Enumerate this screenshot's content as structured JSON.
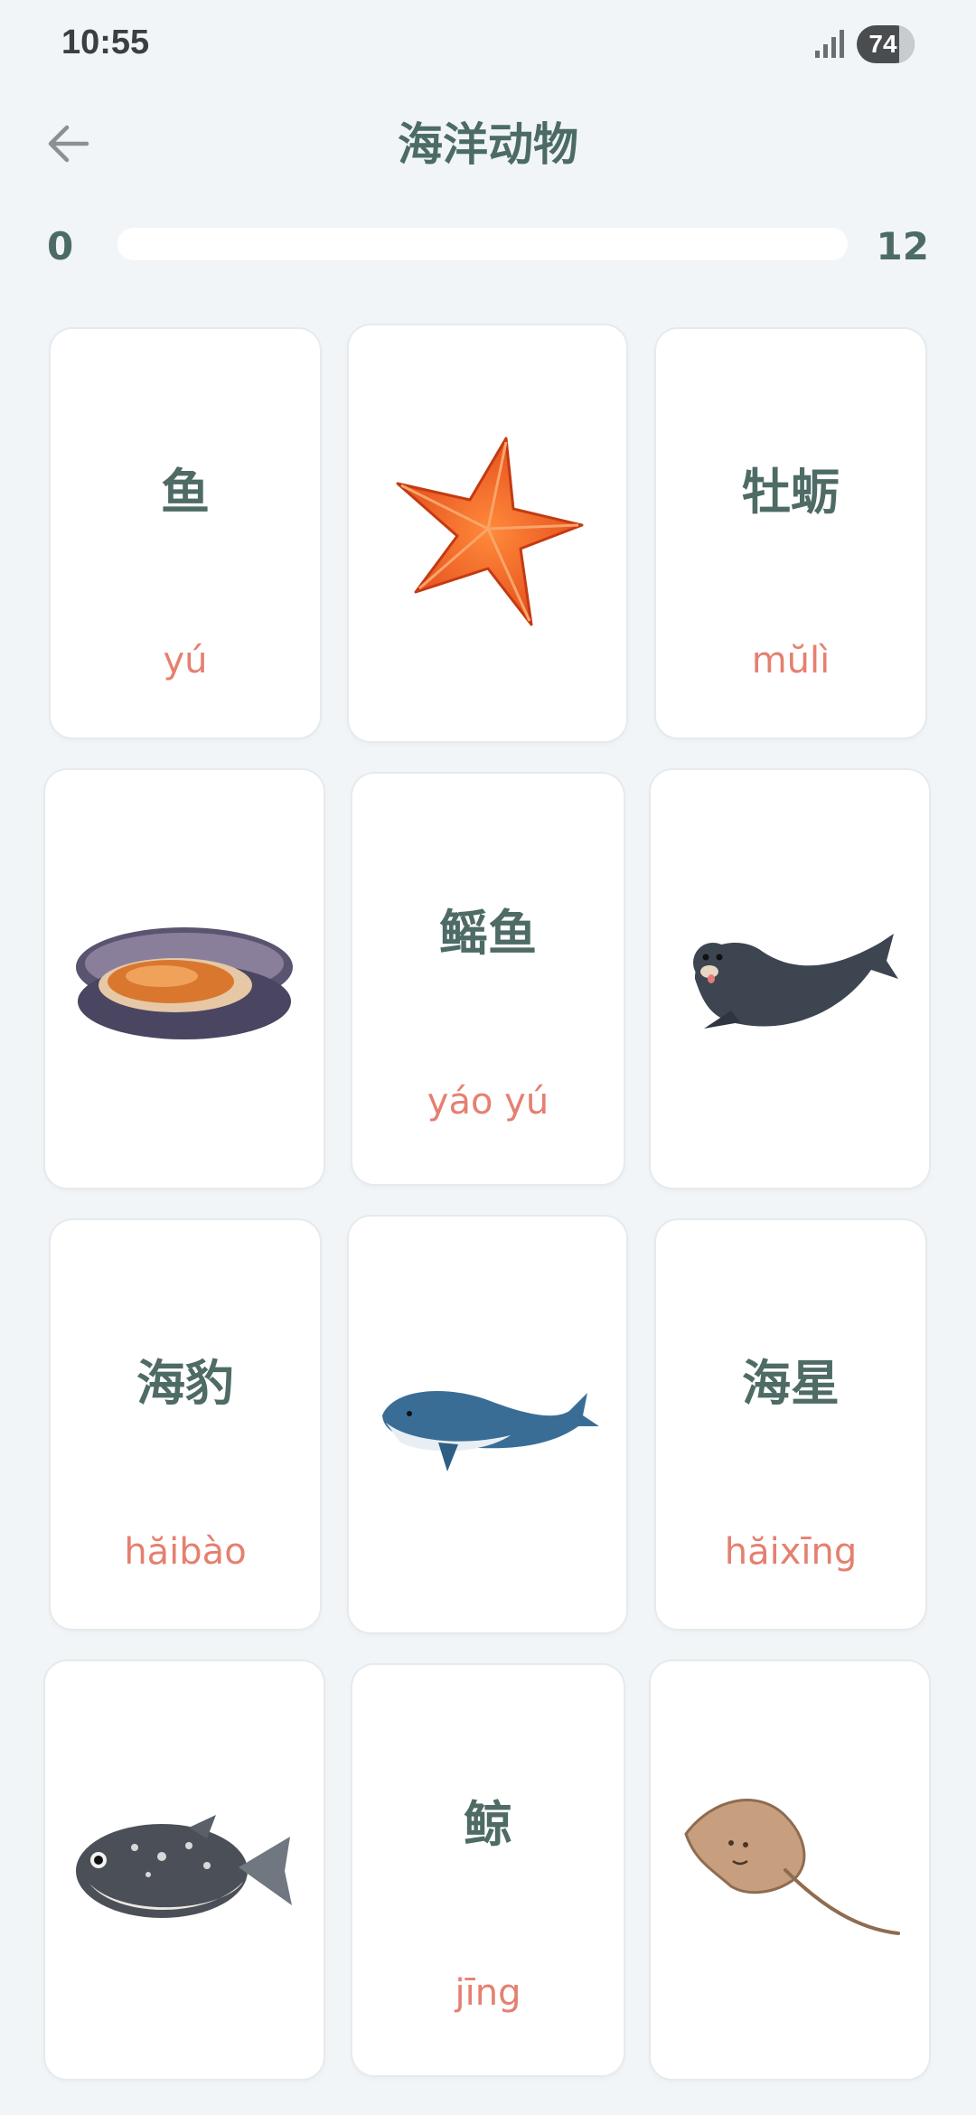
{
  "status": {
    "time": "10:55",
    "battery": "74",
    "battery_level_percent": 74
  },
  "header": {
    "title": "海洋动物"
  },
  "progress": {
    "current": "0",
    "total": "12",
    "value": 0
  },
  "cards": [
    {
      "type": "word",
      "word": "鱼",
      "pinyin": "yú"
    },
    {
      "type": "image",
      "icon": "starfish-image"
    },
    {
      "type": "word",
      "word": "牡蛎",
      "pinyin": "mŭlì"
    },
    {
      "type": "image",
      "icon": "oyster-image"
    },
    {
      "type": "word",
      "word": "鳐鱼",
      "pinyin": "yáo yú"
    },
    {
      "type": "image",
      "icon": "seal-image"
    },
    {
      "type": "word",
      "word": "海豹",
      "pinyin": "hăibào"
    },
    {
      "type": "image",
      "icon": "whale-image"
    },
    {
      "type": "word",
      "word": "海星",
      "pinyin": "hăixīng"
    },
    {
      "type": "image",
      "icon": "pufferfish-image"
    },
    {
      "type": "word",
      "word": "鲸",
      "pinyin": "jīng"
    },
    {
      "type": "image",
      "icon": "stingray-image"
    }
  ],
  "colors": {
    "background": "#f1f5f8",
    "title": "#4c6b67",
    "word": "#4e6b66",
    "pinyin": "#e58070",
    "card": "#ffffff"
  }
}
